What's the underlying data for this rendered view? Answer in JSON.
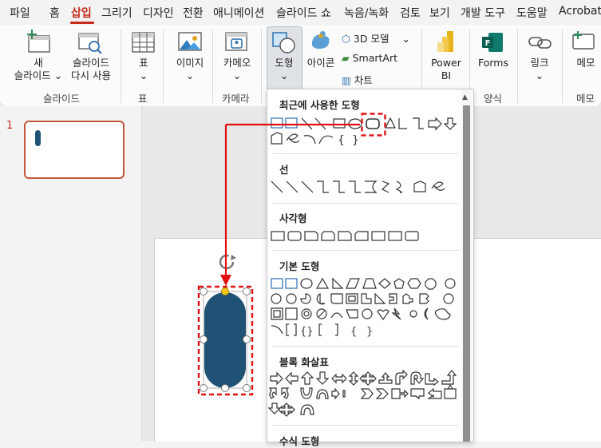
{
  "menu_tabs": [
    "파일",
    "홈",
    "삽입",
    "그리기",
    "디자인",
    "전환",
    "애니메이션",
    "슬라이드 쇼",
    "녹음/녹화",
    "검토",
    "보기",
    "개발 도구",
    "도움말",
    "Acrobat"
  ],
  "active_tab": "삽입",
  "ribbon": {
    "new_slide": [
      "새",
      "슬라이드"
    ],
    "reuse_slide": [
      "슬라이드",
      "다시 사용"
    ],
    "table": "표",
    "image": "이미지",
    "cameo": "카메오",
    "shapes": "도형",
    "icons": "아이콘",
    "model3d": "3D 모델",
    "smartart": "SmartArt",
    "chart": "차트",
    "powerbi": [
      "Power",
      "BI"
    ],
    "forms": "Forms",
    "link": "링크",
    "comment": "메모",
    "groups": {
      "slides": "슬라이드",
      "tables": "표",
      "camera": "카메라",
      "form": "양식",
      "comments": "메모"
    }
  },
  "slide_pane": {
    "number": "1"
  },
  "shape_menu": {
    "sections": [
      "최근에 사용한 도형",
      "선",
      "사각형",
      "기본 도형",
      "블록 화살표",
      "수식 도형"
    ]
  },
  "colors": {
    "accent": "#c42b1c",
    "shape_fill": "#1f5275",
    "callout": "#e01010"
  }
}
